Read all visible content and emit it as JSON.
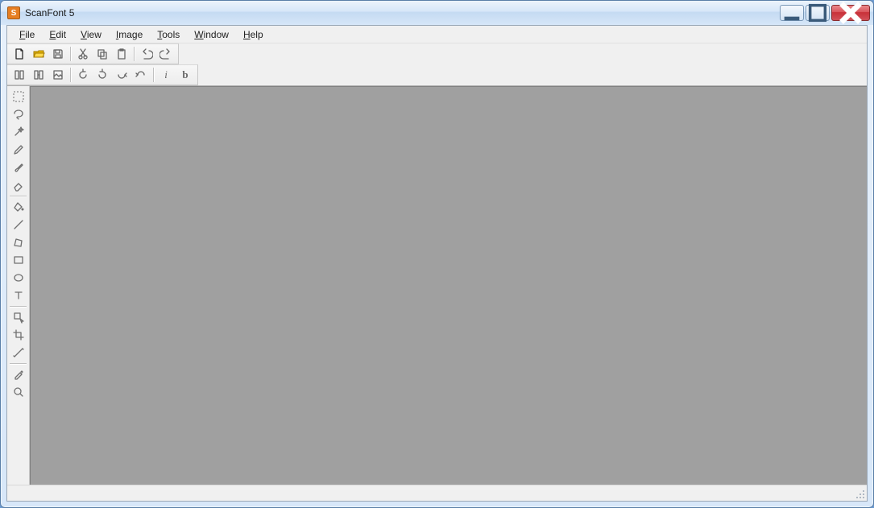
{
  "window": {
    "title": "ScanFont 5",
    "app_icon_letter": "S"
  },
  "menu": {
    "items": [
      {
        "label": "File",
        "underline_index": 0
      },
      {
        "label": "Edit",
        "underline_index": 0
      },
      {
        "label": "View",
        "underline_index": 0
      },
      {
        "label": "Image",
        "underline_index": 0
      },
      {
        "label": "Tools",
        "underline_index": 0
      },
      {
        "label": "Window",
        "underline_index": 0
      },
      {
        "label": "Help",
        "underline_index": 0
      }
    ]
  },
  "toolbar1": {
    "groups": [
      {
        "items": [
          {
            "name": "new-icon",
            "enabled": true
          },
          {
            "name": "open-icon",
            "enabled": true
          },
          {
            "name": "save-icon",
            "enabled": false
          }
        ]
      },
      {
        "items": [
          {
            "name": "cut-icon",
            "enabled": false
          },
          {
            "name": "copy-icon",
            "enabled": false
          },
          {
            "name": "paste-icon",
            "enabled": false
          }
        ]
      },
      {
        "items": [
          {
            "name": "undo-icon",
            "enabled": false
          },
          {
            "name": "redo-icon",
            "enabled": false
          }
        ]
      }
    ]
  },
  "toolbar2": {
    "groups": [
      {
        "items": [
          {
            "name": "separate-icon",
            "enabled": false
          },
          {
            "name": "merge-icon",
            "enabled": false
          },
          {
            "name": "place-icon",
            "enabled": false
          }
        ]
      },
      {
        "items": [
          {
            "name": "rotate-ccw-icon",
            "enabled": false
          },
          {
            "name": "rotate-cw-icon",
            "enabled": false
          },
          {
            "name": "flip-h-icon",
            "enabled": false
          },
          {
            "name": "flip-v-icon",
            "enabled": false
          }
        ]
      },
      {
        "items": [
          {
            "name": "italic-icon",
            "enabled": false,
            "glyph": "i"
          },
          {
            "name": "bold-icon",
            "enabled": false,
            "glyph": "b"
          }
        ]
      }
    ]
  },
  "tools": {
    "items": [
      {
        "name": "marquee-tool-icon"
      },
      {
        "name": "lasso-tool-icon"
      },
      {
        "name": "magic-wand-tool-icon"
      },
      {
        "name": "pencil-tool-icon"
      },
      {
        "name": "brush-tool-icon"
      },
      {
        "name": "eraser-tool-icon"
      },
      {
        "separator": true
      },
      {
        "name": "fill-tool-icon"
      },
      {
        "name": "line-tool-icon"
      },
      {
        "name": "polygon-tool-icon"
      },
      {
        "name": "rectangle-tool-icon"
      },
      {
        "name": "ellipse-tool-icon"
      },
      {
        "name": "text-tool-icon"
      },
      {
        "separator": true
      },
      {
        "name": "move-tool-icon"
      },
      {
        "name": "crop-tool-icon"
      },
      {
        "name": "measure-tool-icon"
      },
      {
        "separator": true
      },
      {
        "name": "eyedropper-tool-icon"
      },
      {
        "name": "zoom-tool-icon"
      }
    ]
  }
}
